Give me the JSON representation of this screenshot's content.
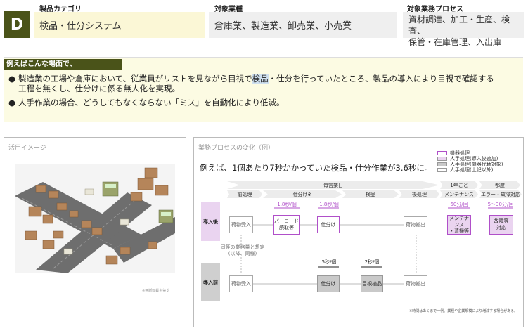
{
  "header": {
    "badge": "D",
    "category_label": "製品カテゴリ",
    "category_value": "検品・仕分システム",
    "industry_label": "対象業種",
    "industry_value": "倉庫業、製造業、卸売業、小売業",
    "process_label": "対象業務プロセス",
    "process_line1": "資材調達、加工・生産、検査、",
    "process_line2": "保管・在庫管理、入出庫"
  },
  "examples": {
    "title": "例えばこんな場面で、",
    "bullet1_part1": "製造業の工場や倉庫において、従業員がリストを見ながら目視で",
    "bullet1_highlight": "検品",
    "bullet1_part2": "・仕分を行っていたところ、製品の導入により目視で確認する",
    "bullet1_line2": "工程を無くし、仕分けに係る無人化を実現。",
    "bullet2": "人手作業の場合、どうしてもなくならない「ミス」を自動化により低減。"
  },
  "usage": {
    "title": "活用イメージ",
    "note": "※無断転載を禁ず"
  },
  "process": {
    "title": "業務プロセスの変化（例）",
    "headline": "例えば、1個あたり7秒かかっていた検品・仕分作業が3.6秒に。",
    "legend": [
      {
        "label": "機器処理",
        "color": "#b04fc9"
      },
      {
        "label": "人手処理(導入後追加)",
        "color": "#ead4f0"
      },
      {
        "label": "人手処理(機器代替対象)",
        "color": "#c9c9c9"
      },
      {
        "label": "人手処理(上記以外)",
        "color": "#ffffff"
      }
    ],
    "top_bars": {
      "daily": "毎営業日",
      "yearly": "1年ごと",
      "asneeded": "都度"
    },
    "phases": {
      "pre": "前処理",
      "sort": "仕分け※",
      "inspect": "検品",
      "post": "後処理",
      "maint": "メンテナンス",
      "error": "エラー・故障対応"
    },
    "row_after": "導入後",
    "row_before": "導入前",
    "nodes": {
      "receive": "荷物受入",
      "barcode": "バーコード\n読取等",
      "sort": "仕分け",
      "ship": "荷物搬出",
      "maint": "メンテナンス\n・清掃等",
      "fault": "故障等\n対応",
      "visual": "目視検品"
    },
    "times": {
      "barcode": "1.8秒/個",
      "sort_after": "1.8秒/個",
      "maint": "60分/回",
      "fault": "5〜30分/回",
      "sort_before": "5秒/個",
      "visual": "2秒/個"
    },
    "same_note": "同等の業務量と想定\n(以降、同様)",
    "footnote": "※時間はあくまで一例。業種や企業規模により増減する場合がある。"
  }
}
